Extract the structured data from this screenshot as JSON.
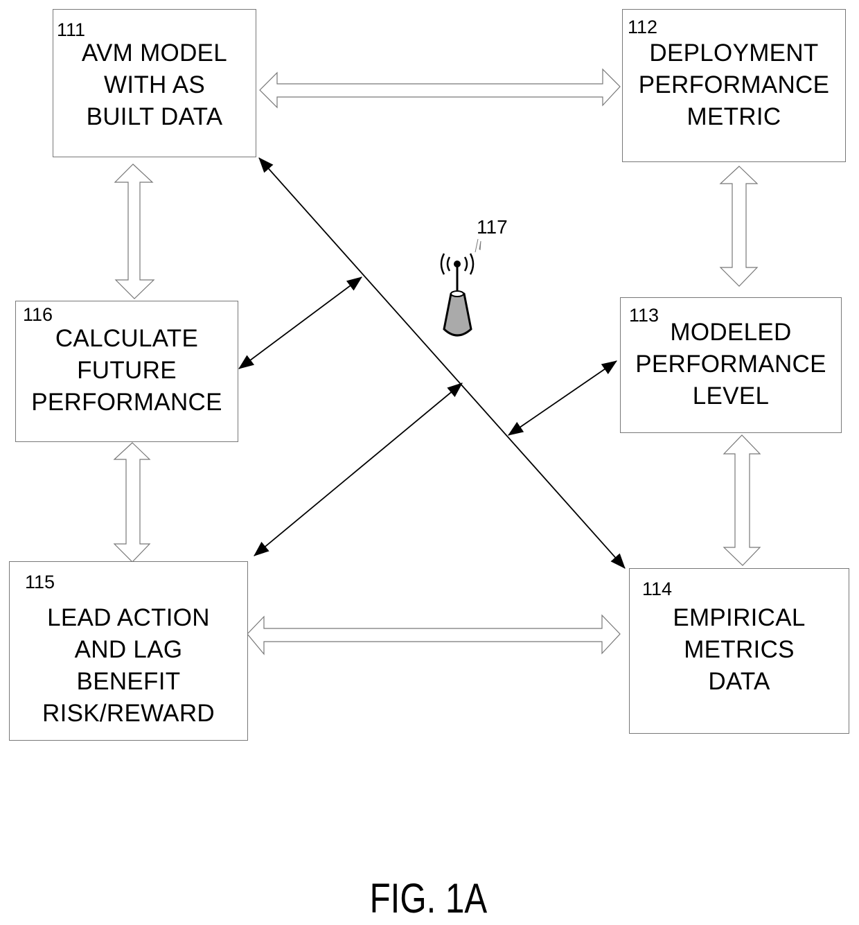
{
  "figure_label": "FIG. 1A",
  "nodes": {
    "n111": {
      "ref": "111",
      "text": "AVM MODEL\nWITH AS\nBUILT DATA"
    },
    "n112": {
      "ref": "112",
      "text": "DEPLOYMENT\nPERFORMANCE\nMETRIC"
    },
    "n113": {
      "ref": "113",
      "text": "MODELED\nPERFORMANCE\nLEVEL"
    },
    "n114": {
      "ref": "114",
      "text": "EMPIRICAL\nMETRICS\nDATA"
    },
    "n115": {
      "ref": "115",
      "text": "LEAD ACTION\nAND LAG\nBENEFIT\nRISK/REWARD"
    },
    "n116": {
      "ref": "116",
      "text": "CALCULATE\nFUTURE\nPERFORMANCE"
    }
  },
  "antenna": {
    "ref": "117",
    "icon": "wireless-antenna-icon"
  },
  "connections": [
    {
      "from": "111",
      "to": "112",
      "type": "hollow-double-arrow"
    },
    {
      "from": "112",
      "to": "113",
      "type": "hollow-double-arrow"
    },
    {
      "from": "113",
      "to": "114",
      "type": "hollow-double-arrow"
    },
    {
      "from": "114",
      "to": "115",
      "type": "hollow-double-arrow"
    },
    {
      "from": "115",
      "to": "116",
      "type": "hollow-double-arrow"
    },
    {
      "from": "116",
      "to": "111",
      "type": "hollow-double-arrow"
    },
    {
      "from": "111",
      "to": "114",
      "type": "line-double-arrow"
    },
    {
      "from": "116",
      "to": "111-114 link",
      "type": "line-double-arrow"
    },
    {
      "from": "115",
      "to": "111-114 link",
      "type": "line-double-arrow"
    },
    {
      "from": "113",
      "to": "111-114 link",
      "type": "line-double-arrow"
    }
  ]
}
